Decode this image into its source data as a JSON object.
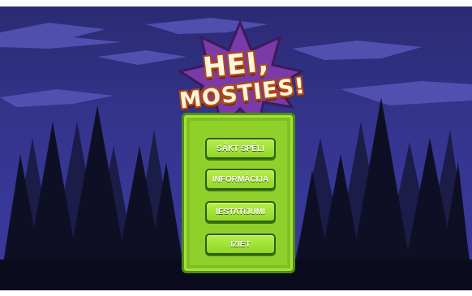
{
  "logo": {
    "line1": "HEI,",
    "line2": "MOSTIES!"
  },
  "menu": {
    "start_label": "SĀKT SPĒLI",
    "info_label": "INFORMĀCIJA",
    "settings_label": "IESTATĪJUMI",
    "exit_label": "IZIET"
  },
  "colors": {
    "sky": "#2a2a72",
    "forest": "#0e0f24",
    "panel": "#8fd12a",
    "button": "#a8e63c",
    "starburst": "#7a3aa8"
  }
}
